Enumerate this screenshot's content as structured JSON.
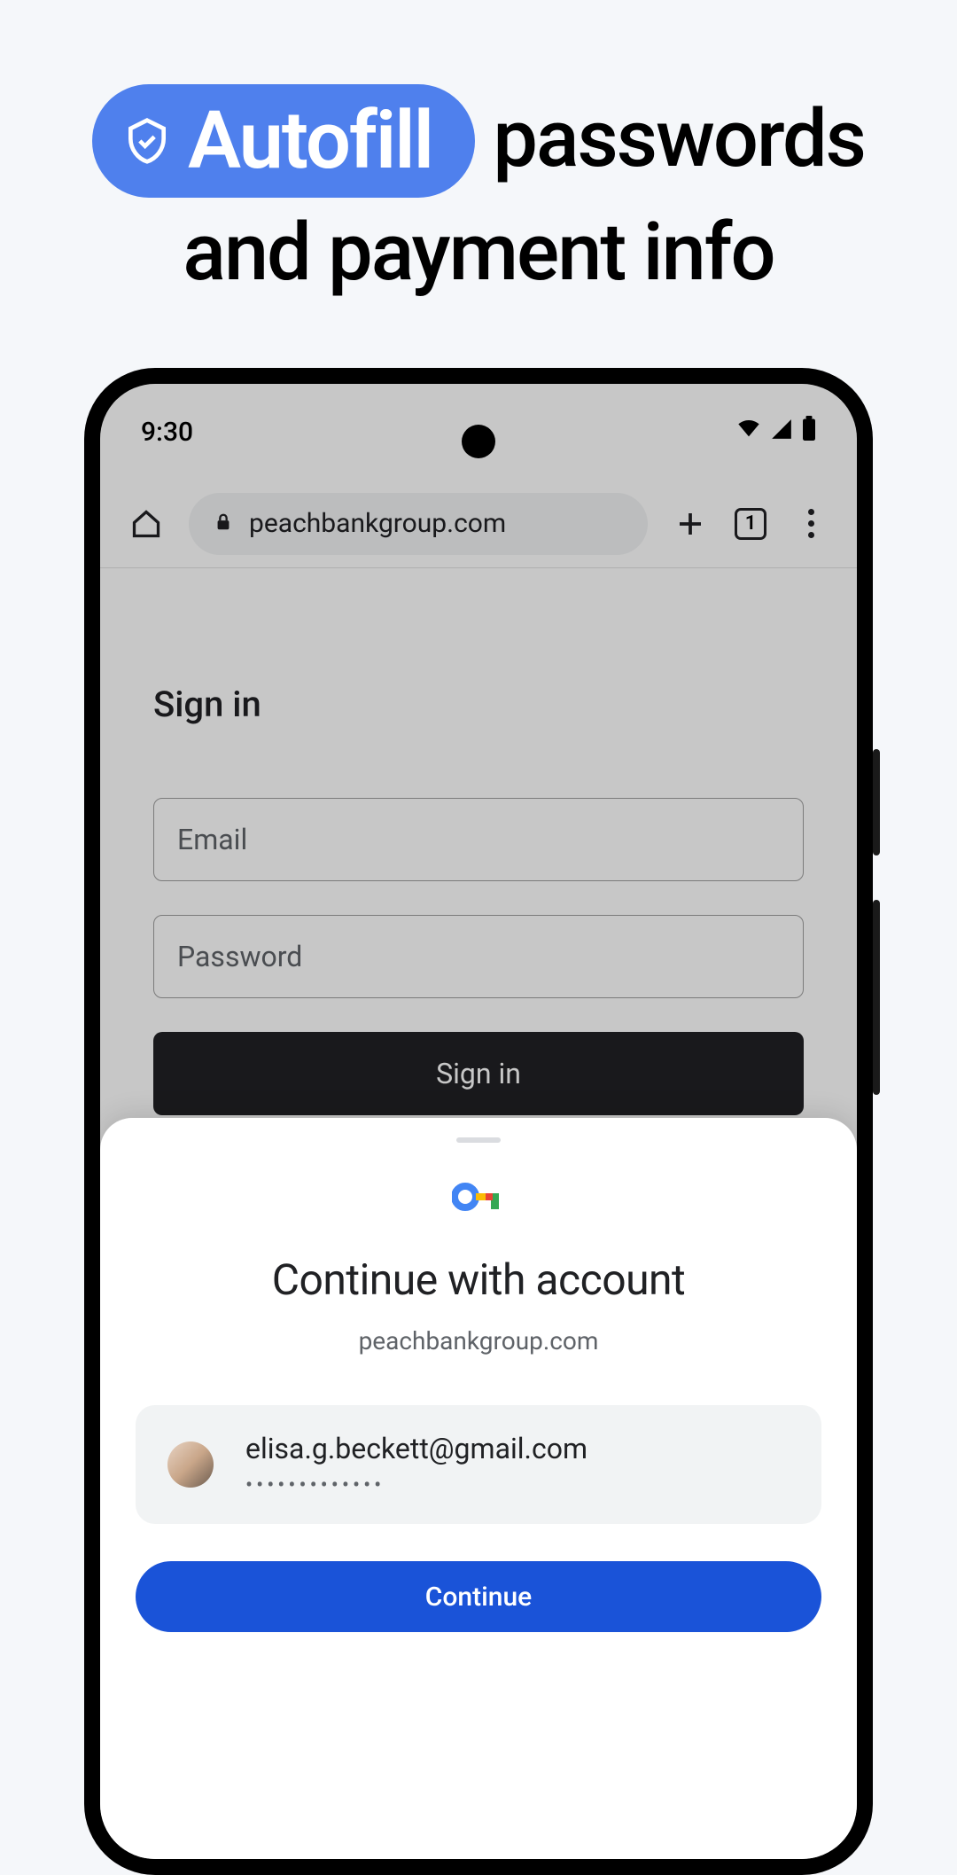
{
  "headline": {
    "badge": "Autofill",
    "word1": "passwords",
    "line2": "and payment info"
  },
  "statusbar": {
    "time": "9:30"
  },
  "browser": {
    "url": "peachbankgroup.com",
    "tab_count": "1"
  },
  "page": {
    "heading": "Sign in",
    "email_placeholder": "Email",
    "password_placeholder": "Password",
    "signin_button": "Sign in"
  },
  "sheet": {
    "title": "Continue with account",
    "domain": "peachbankgroup.com",
    "account_email": "elisa.g.beckett@gmail.com",
    "account_password_mask": "•••••••••••••",
    "continue_button": "Continue"
  },
  "colors": {
    "badge_blue": "#4f80ed",
    "continue_blue": "#1a53d8"
  }
}
